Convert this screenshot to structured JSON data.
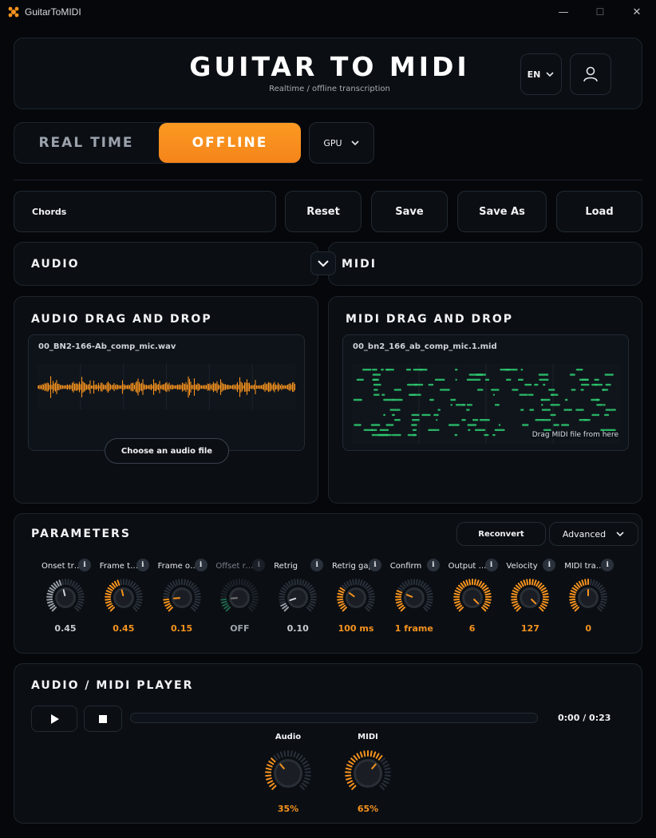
{
  "window": {
    "title": "GuitarToMIDI",
    "minimize": "—",
    "maximize": "☐",
    "close": "✕"
  },
  "header": {
    "title": "GUITAR TO MIDI",
    "subtitle": "Realtime / offline transcription",
    "language": "EN"
  },
  "mode": {
    "realtime": "REAL TIME",
    "offline": "OFFLINE",
    "device": "GPU",
    "active": "offline"
  },
  "toolbar": {
    "chords": "Chords",
    "reset": "Reset",
    "save": "Save",
    "save_as": "Save As",
    "load": "Load"
  },
  "sections": {
    "audio": "AUDIO",
    "midi": "MIDI"
  },
  "audio_drop": {
    "title": "AUDIO DRAG AND DROP",
    "filename": "00_BN2-166-Ab_comp_mic.wav",
    "choose": "Choose an audio file"
  },
  "midi_drop": {
    "title": "MIDI DRAG AND DROP",
    "filename": "00_bn2_166_ab_comp_mic.1.mid",
    "hint": "Drag MIDI file from here"
  },
  "parameters": {
    "title": "PARAMETERS",
    "reconvert": "Reconvert",
    "advanced": "Advanced",
    "info": "i",
    "knobs": [
      {
        "label": "Onset trigg...",
        "value": "0.45",
        "level": 0.45,
        "color": "#9aa0a8",
        "dim": false
      },
      {
        "label": "Frame trig...",
        "value": "0.45",
        "level": 0.45,
        "color": "#f7931e",
        "dim": false
      },
      {
        "label": "Frame offset",
        "value": "0.15",
        "level": 0.15,
        "color": "#f7931e",
        "dim": false
      },
      {
        "label": "Offset rele...",
        "value": "OFF",
        "level": 0.15,
        "color": "#2e9d6e",
        "dim": true
      },
      {
        "label": "Retrig",
        "value": "0.10",
        "level": 0.1,
        "color": "#9aa0a8",
        "dim": false
      },
      {
        "label": "Retrig gap",
        "value": "100 ms",
        "level": 0.3,
        "color": "#f7931e",
        "dim": false
      },
      {
        "label": "Confirm",
        "value": "1 frame",
        "level": 0.25,
        "color": "#f7931e",
        "dim": false
      },
      {
        "label": "Output not...",
        "value": "6",
        "level": 1.0,
        "color": "#f7931e",
        "dim": false
      },
      {
        "label": "Velocity",
        "value": "127",
        "level": 1.0,
        "color": "#f7931e",
        "dim": false
      },
      {
        "label": "MIDI trans...",
        "value": "0",
        "level": 0.5,
        "color": "#f7931e",
        "dim": false
      }
    ]
  },
  "player": {
    "title": "AUDIO / MIDI PLAYER",
    "time": "0:00 / 0:23",
    "progress": 0,
    "audio_label": "Audio",
    "audio_value": "35%",
    "audio_level": 0.35,
    "midi_label": "MIDI",
    "midi_value": "65%",
    "midi_level": 0.65
  },
  "colors": {
    "accent": "#f7931e",
    "midi_note": "#2ecc71",
    "panel": "#0b0f14"
  },
  "icons": {
    "app": "guitar-logo-icon",
    "lang": "chevron-down-icon",
    "user": "user-icon",
    "play": "play-icon",
    "stop": "stop-icon"
  }
}
